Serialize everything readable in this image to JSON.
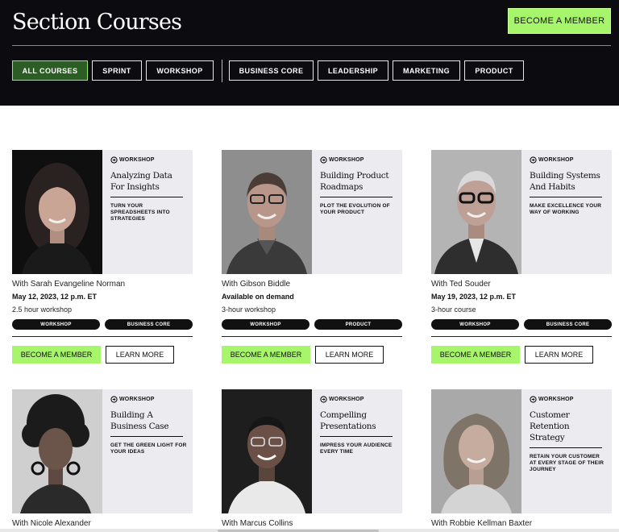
{
  "header": {
    "title": "Section Courses",
    "cta_label": "BECOME A MEMBER",
    "filters": [
      "ALL COURSES",
      "SPRINT",
      "WORKSHOP",
      "BUSINESS CORE",
      "LEADERSHIP",
      "MARKETING",
      "PRODUCT"
    ],
    "active_filter": "ALL COURSES"
  },
  "colors": {
    "header_bg": "#0b0b10",
    "accent_green": "#a6f56b",
    "banner_bg": "#ebebf0"
  },
  "courses": [
    {
      "type": "WORKSHOP",
      "title": "Analyzing Data For Insights",
      "subtitle": "TURN YOUR SPREADSHEETS INTO STRATEGIES",
      "instructor": "With Sarah Evangeline Norman",
      "date": "May 12, 2023, 12 p.m. ET",
      "format": "2.5 hour workshop",
      "tags": [
        "WORKSHOP",
        "BUSINESS CORE"
      ],
      "member_label": "BECOME A MEMBER",
      "learn_label": "LEARN MORE"
    },
    {
      "type": "WORKSHOP",
      "title": "Building Product Roadmaps",
      "subtitle": "PLOT THE EVOLUTION OF YOUR PRODUCT",
      "instructor": "With Gibson Biddle",
      "date": "Available on demand",
      "format": "3-hour workshop",
      "tags": [
        "WORKSHOP",
        "PRODUCT"
      ],
      "member_label": "BECOME A MEMBER",
      "learn_label": "LEARN MORE"
    },
    {
      "type": "WORKSHOP",
      "title": "Building Systems And Habits",
      "subtitle": "MAKE EXCELLENCE YOUR WAY OF WORKING",
      "instructor": "With Ted Souder",
      "date": "May 19, 2023, 12 p.m. ET",
      "format": "3-hour course",
      "tags": [
        "WORKSHOP",
        "BUSINESS CORE"
      ],
      "member_label": "BECOME A MEMBER",
      "learn_label": "LEARN MORE"
    },
    {
      "type": "WORKSHOP",
      "title": "Building A Business Case",
      "subtitle": "GET THE GREEN LIGHT FOR YOUR IDEAS",
      "instructor": "With Nicole Alexander"
    },
    {
      "type": "WORKSHOP",
      "title": "Compelling Presentations",
      "subtitle": "IMPRESS YOUR AUDIENCE EVERY TIME",
      "instructor": "With Marcus Collins"
    },
    {
      "type": "WORKSHOP",
      "title": "Customer Retention Strategy",
      "subtitle": "RETAIN YOUR CUSTOMER AT EVERY STAGE OF THEIR JOURNEY",
      "instructor": "With Robbie Kellman Baxter"
    }
  ]
}
